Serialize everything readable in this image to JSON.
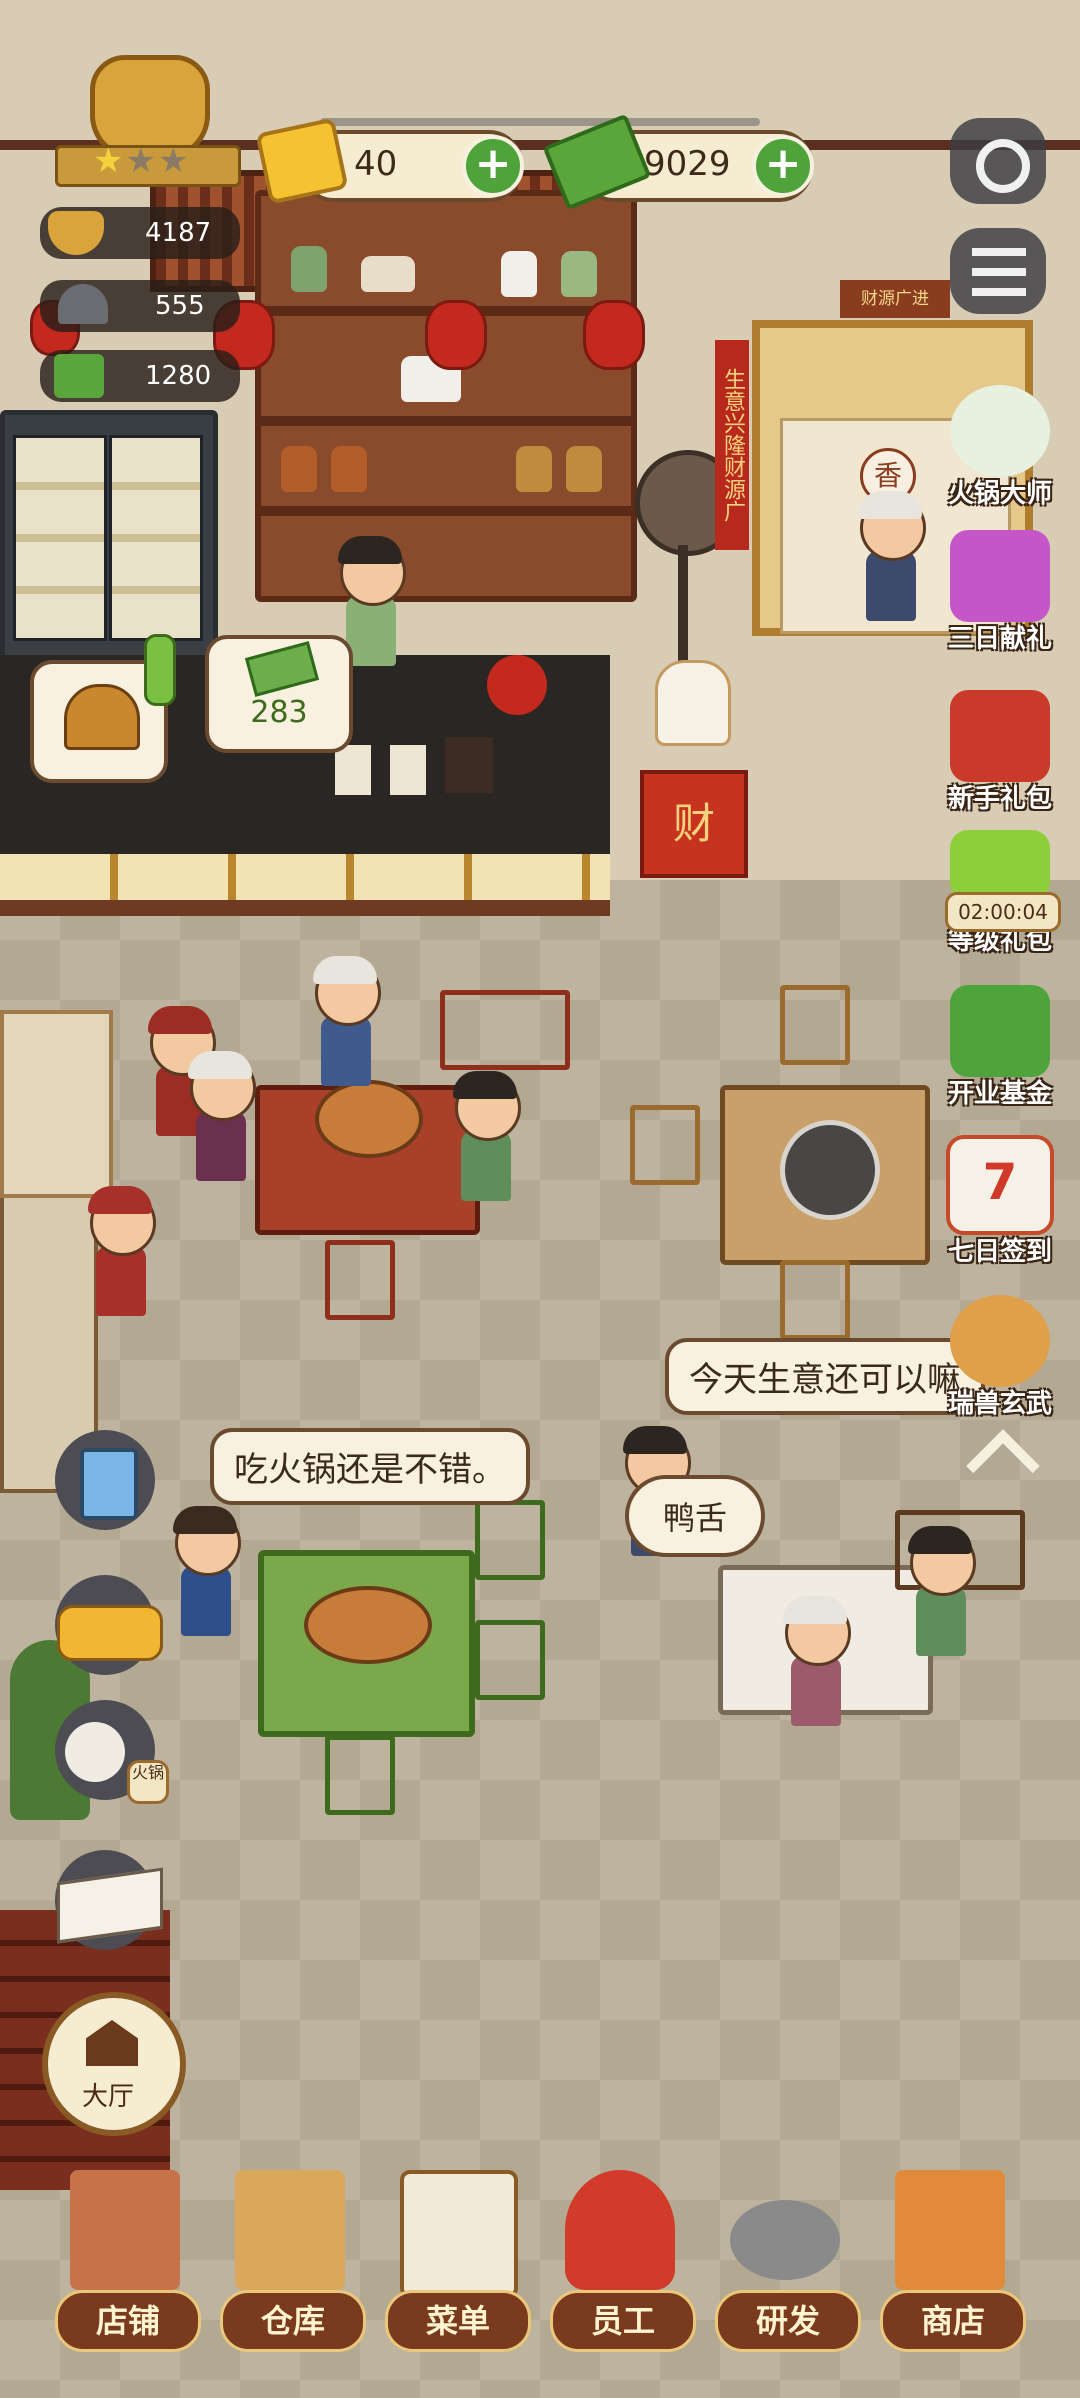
{
  "hud": {
    "rank_stars": 1,
    "stats": [
      {
        "icon": "hotpot-icon",
        "value": "4187"
      },
      {
        "icon": "service-bell-icon",
        "value": "555"
      },
      {
        "icon": "cash-register-icon",
        "value": "1280"
      }
    ],
    "gems": "40",
    "cash": "9029"
  },
  "side_menu": [
    {
      "id": "master",
      "label": "火锅大师",
      "icon": "panda-chef-icon"
    },
    {
      "id": "three-day",
      "label": "三日献礼",
      "icon": "gift-box-icon"
    },
    {
      "id": "newbie",
      "label": "新手礼包",
      "icon": "treasure-pack-icon"
    },
    {
      "id": "level",
      "label": "等级礼包",
      "icon": "level-pack-icon",
      "timer": "02:00:04"
    },
    {
      "id": "fund",
      "label": "开业基金",
      "icon": "money-chest-icon"
    },
    {
      "id": "signin",
      "label": "七日签到",
      "icon": "calendar-icon",
      "badge": "7"
    },
    {
      "id": "beast",
      "label": "瑞兽玄武",
      "icon": "cat-turtle-icon"
    }
  ],
  "scene": {
    "counter_cash_bubble": "283",
    "shop_sign": "财源广进",
    "fortune_box": "财",
    "fortune_scroll": "生意兴隆财源广",
    "incense_sign": "香",
    "speech": [
      {
        "id": "hotpot-comment",
        "text": "吃火锅还是不错。"
      },
      {
        "id": "business-comment",
        "text": "今天生意还可以嘛"
      },
      {
        "id": "order-duck-tongue",
        "text": "鸭舌"
      }
    ],
    "delivery_tag": "火锅"
  },
  "hall_button": {
    "label": "大厅"
  },
  "bottom_nav": [
    {
      "label": "店铺",
      "icon": "storefront-icon"
    },
    {
      "label": "仓库",
      "icon": "boxes-icon"
    },
    {
      "label": "菜单",
      "icon": "clipboard-icon"
    },
    {
      "label": "员工",
      "icon": "staff-icon"
    },
    {
      "label": "研发",
      "icon": "wok-icon"
    },
    {
      "label": "商店",
      "icon": "shop-icon"
    }
  ],
  "colors": {
    "accent_green": "#4ea33b",
    "wood_dark": "#5c2b18",
    "lantern_red": "#c4291e"
  }
}
